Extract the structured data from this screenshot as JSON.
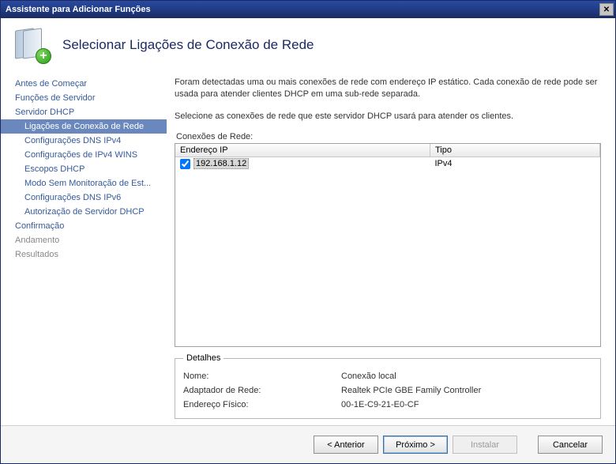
{
  "titlebar": {
    "title": "Assistente para Adicionar Funções"
  },
  "header": {
    "heading": "Selecionar Ligações de Conexão de Rede"
  },
  "sidebar": {
    "items": [
      {
        "label": "Antes de Começar",
        "sub": false,
        "selected": false
      },
      {
        "label": "Funções de Servidor",
        "sub": false,
        "selected": false
      },
      {
        "label": "Servidor DHCP",
        "sub": false,
        "selected": false
      },
      {
        "label": "Ligações de Conexão de Rede",
        "sub": true,
        "selected": true
      },
      {
        "label": "Configurações DNS IPv4",
        "sub": true,
        "selected": false
      },
      {
        "label": "Configurações de IPv4 WINS",
        "sub": true,
        "selected": false
      },
      {
        "label": "Escopos DHCP",
        "sub": true,
        "selected": false
      },
      {
        "label": "Modo Sem Monitoração de Est...",
        "sub": true,
        "selected": false
      },
      {
        "label": "Configurações DNS IPv6",
        "sub": true,
        "selected": false
      },
      {
        "label": "Autorização de Servidor DHCP",
        "sub": true,
        "selected": false
      },
      {
        "label": "Confirmação",
        "sub": false,
        "selected": false
      },
      {
        "label": "Andamento",
        "sub": false,
        "selected": false,
        "disabled": true
      },
      {
        "label": "Resultados",
        "sub": false,
        "selected": false,
        "disabled": true
      }
    ]
  },
  "main": {
    "desc1": "Foram detectadas uma ou mais conexões de rede com endereço IP estático. Cada conexão de rede pode ser usada para atender clientes DHCP em uma sub-rede separada.",
    "desc2": "Selecione as conexões de rede que este servidor DHCP usará para atender os clientes.",
    "table_label": "Conexões de Rede:",
    "columns": {
      "ip": "Endereço IP",
      "type": "Tipo"
    },
    "rows": [
      {
        "checked": true,
        "ip": "192.168.1.12",
        "type": "IPv4"
      }
    ],
    "details": {
      "legend": "Detalhes",
      "name_label": "Nome:",
      "name_value": "Conexão local",
      "adapter_label": "Adaptador de Rede:",
      "adapter_value": "Realtek PCIe GBE Family Controller",
      "mac_label": "Endereço Físico:",
      "mac_value": "00-1E-C9-21-E0-CF"
    }
  },
  "footer": {
    "prev": "< Anterior",
    "next": "Próximo >",
    "install": "Instalar",
    "cancel": "Cancelar"
  }
}
